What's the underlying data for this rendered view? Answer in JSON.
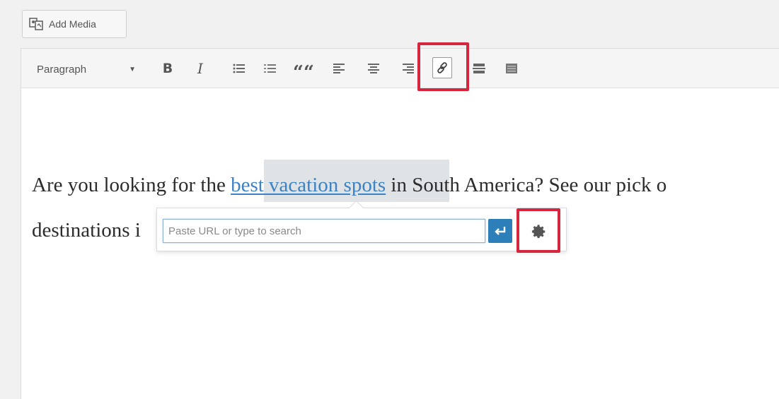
{
  "toolbar_top": {
    "add_media_label": "Add Media"
  },
  "editor_toolbar": {
    "format_select": "Paragraph",
    "bold": "B",
    "italic": "I",
    "blockquote": "““"
  },
  "content": {
    "para1_before": "Are you looking for the ",
    "para1_link": "best vacation spots",
    "para1_after": " in South America? See our pick o",
    "para2_before": "destinations i"
  },
  "link_popup": {
    "url_placeholder": "Paste URL or type to search",
    "url_value": ""
  },
  "icons": [
    "add-media-icon",
    "bold-icon",
    "italic-icon",
    "bullet-list-icon",
    "numbered-list-icon",
    "blockquote-icon",
    "align-left-icon",
    "align-center-icon",
    "align-right-icon",
    "link-icon",
    "read-more-icon",
    "toolbar-toggle-icon",
    "apply-enter-icon",
    "gear-icon"
  ],
  "colors": {
    "highlight": "#d6263d",
    "link": "#3c82c4",
    "apply_button": "#2c7fb8"
  }
}
